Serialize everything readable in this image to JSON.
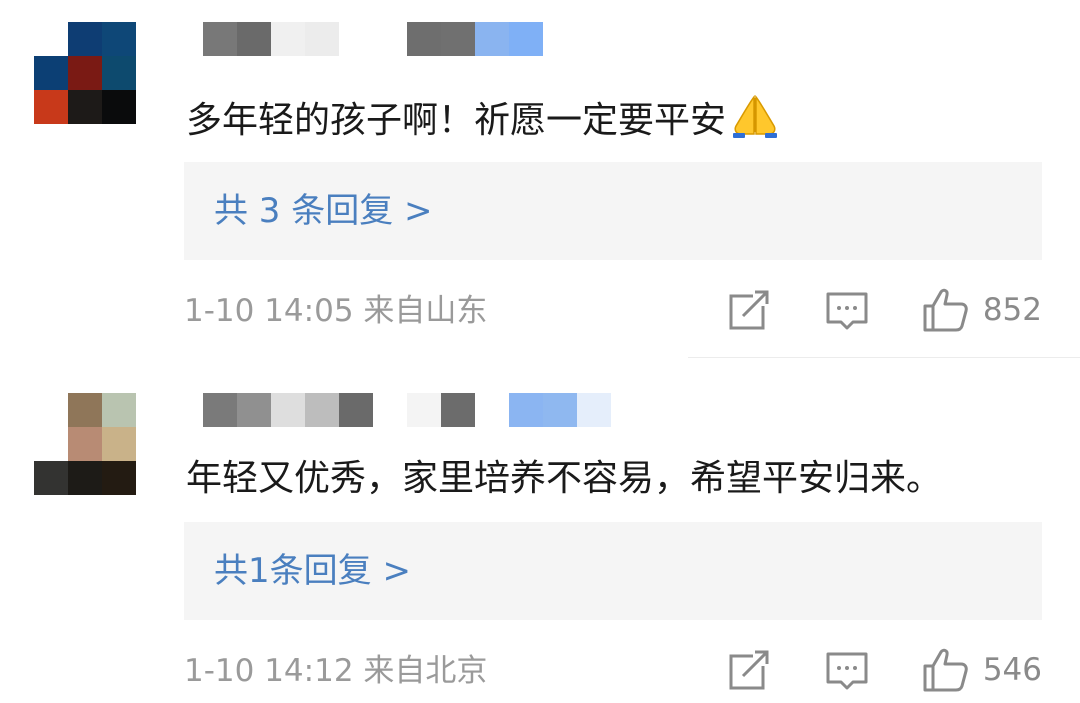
{
  "comments": [
    {
      "text": "多年轻的孩子啊！祈愿一定要平安",
      "emoji": "folded-hands",
      "reply_link": "共 3 条回复 >",
      "time": "1-10 14:05",
      "location": "来自山东",
      "likes": "852",
      "avatar_colors": [
        "#ffffff",
        "#0e3d73",
        "#0e4777",
        "#0c3f74",
        "#7a1a14",
        "#0d4a6e",
        "#c8391a",
        "#1d1a18",
        "#0a0b0c"
      ],
      "nick_colors": [
        "#787878",
        "#6a6a6a",
        "#f0f0f0",
        "#ececec",
        "#ffffff",
        "#ffffff",
        "#6e6e6e",
        "#707070",
        "#8ab4f0",
        "#7fb0f6"
      ]
    },
    {
      "text": "年轻又优秀，家里培养不容易，希望平安归来。",
      "reply_link": "共1条回复 >",
      "time": "1-10 14:12",
      "location": "来自北京",
      "likes": "546",
      "avatar_colors": [
        "#ffffff",
        "#8f7659",
        "#b9c4b0",
        "#ffffff",
        "#b88b74",
        "#c9b289",
        "#333331",
        "#1d1b17",
        "#231b12"
      ],
      "nick_colors": [
        "#7a7a7a",
        "#909090",
        "#dedede",
        "#bdbdbd",
        "#6a6a6a",
        "#ffffff",
        "#f4f4f4",
        "#6c6c6c",
        "#ffffff",
        "#8bb5f2",
        "#8fb8f0",
        "#e5eefb"
      ]
    }
  ],
  "colors": {
    "reply_link": "#4a7fbf",
    "meta": "#9a9a9a",
    "reply_bg": "#f5f5f5"
  }
}
